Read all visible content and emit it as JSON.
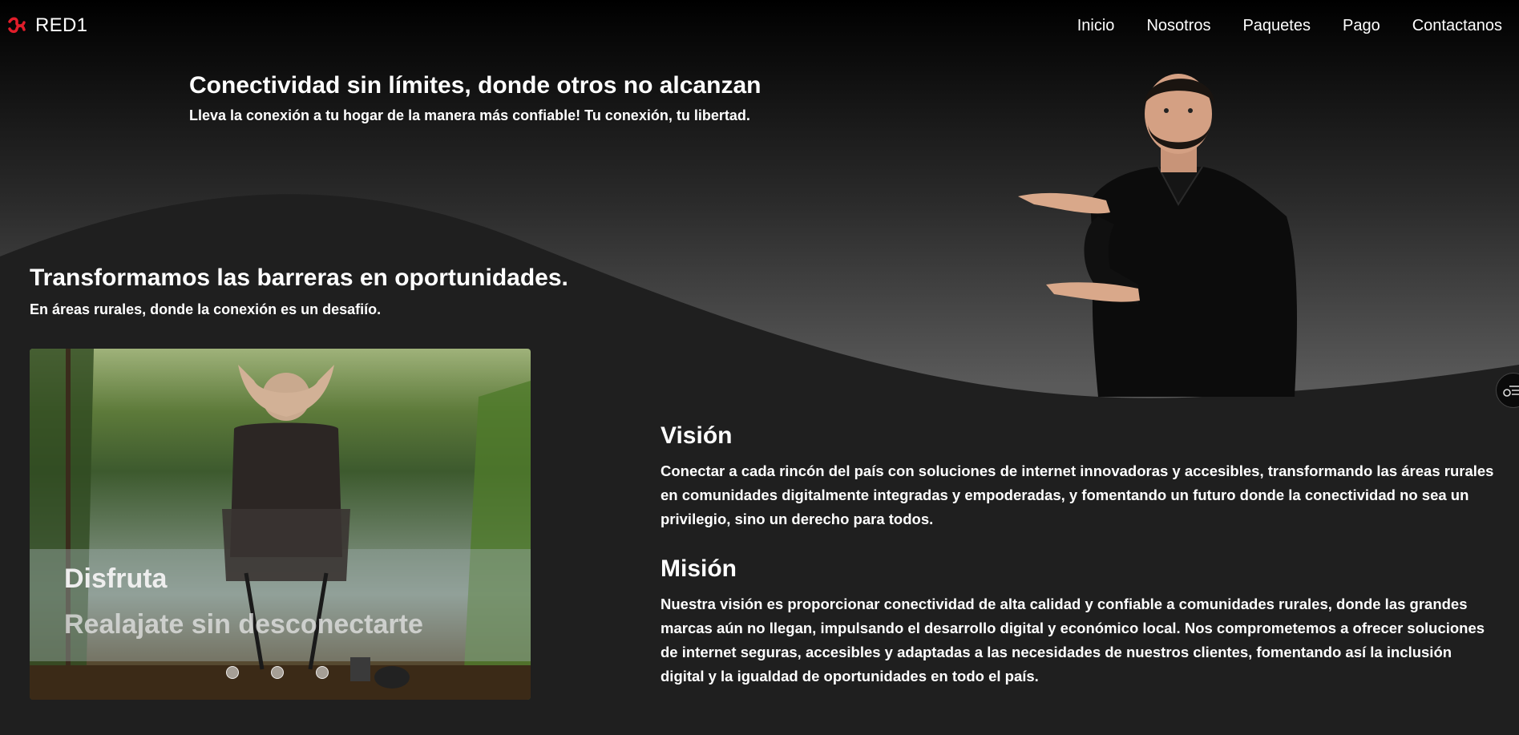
{
  "brand": {
    "name": "RED1",
    "logo_icon": "red1-logo-icon",
    "accent": "#e11d2a"
  },
  "nav": [
    {
      "label": "Inicio"
    },
    {
      "label": "Nosotros"
    },
    {
      "label": "Paquetes"
    },
    {
      "label": "Pago"
    },
    {
      "label": "Contactanos"
    }
  ],
  "hero": {
    "title": "Conectividad sin límites, donde otros no alcanzan",
    "subtitle": "Lleva la conexión a tu hogar de la manera más confiable! Tu conexión, tu libertad."
  },
  "section2": {
    "title": "Transformamos las barreras en oportunidades.",
    "subtitle": "En áreas rurales, donde la conexión es un desafiío."
  },
  "carousel": {
    "caption_title": "Disfruta",
    "caption_sub": "Realajate sin desconectarte",
    "slides": 3
  },
  "vision": {
    "title": "Visión",
    "text": "Conectar a cada rincón del país con soluciones de internet innovadoras y accesibles, transformando las áreas rurales en comunidades digitalmente integradas y empoderadas, y fomentando un futuro donde la conectividad no sea un privilegio, sino un derecho para todos."
  },
  "mision": {
    "title": "Misión",
    "text": "Nuestra visión es proporcionar conectividad de alta calidad y confiable a comunidades rurales, donde las grandes marcas aún no llegan, impulsando el desarrollo digital y económico local. Nos comprometemos a ofrecer soluciones de internet seguras, accesibles y adaptadas a las necesidades de nuestros clientes, fomentando así la inclusión digital y la igualdad de oportunidades en todo el país."
  },
  "floating_button": {
    "icon": "accessibility-menu-icon"
  }
}
